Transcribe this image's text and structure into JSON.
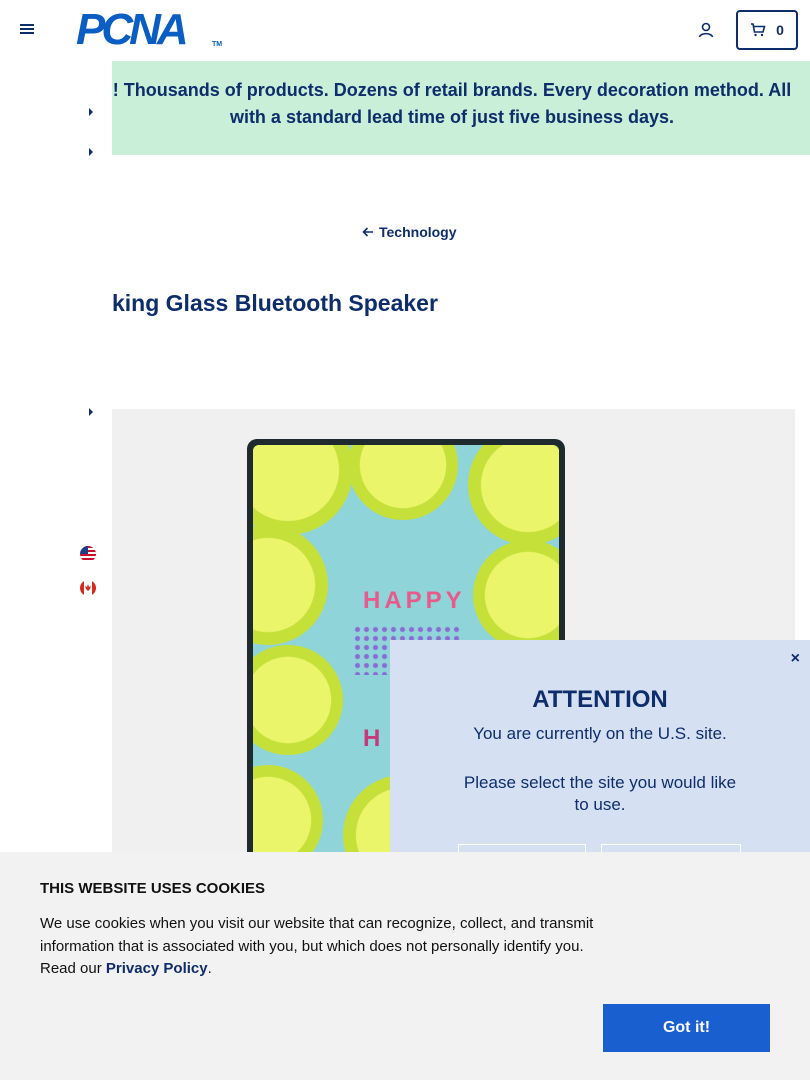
{
  "header": {
    "logo_text": "PCNA",
    "logo_tm": "TM",
    "cart_count": "0"
  },
  "banner": {
    "text_prefix": "! Thousands of products. Dozens of retail brands. Every decoration method. All",
    "text_line2": "with a standard lead time of just five business days."
  },
  "breadcrumb": {
    "back_label": "Technology"
  },
  "product": {
    "title_visible": "king Glass Bluetooth Speaker",
    "image_text": "HAPPY",
    "image_text2": "H"
  },
  "modal": {
    "close_label": "×",
    "title": "ATTENTION",
    "line1": "You are currently on the U.S. site.",
    "line2": "Please select the site you would like to use."
  },
  "cookie": {
    "title": "THIS WEBSITE USES COOKIES",
    "text": "We use cookies when you visit our website that can recognize, collect, and transmit information that is associated with you, but which does not personally identify you. Read our ",
    "link_label": "Privacy Policy",
    "text_end": ".",
    "button_label": "Got it!"
  },
  "colors": {
    "brand_navy": "#0d2d6b",
    "logo_blue": "#0a5dc2",
    "banner_green": "#c9efd9",
    "modal_bg": "#d6e0f3",
    "button_blue": "#1a5fd0"
  },
  "icons": [
    "hamburger-icon",
    "account-icon",
    "cart-icon",
    "chevron-right-icon",
    "arrow-left-icon",
    "us-flag-icon",
    "canada-flag-icon",
    "close-icon"
  ]
}
